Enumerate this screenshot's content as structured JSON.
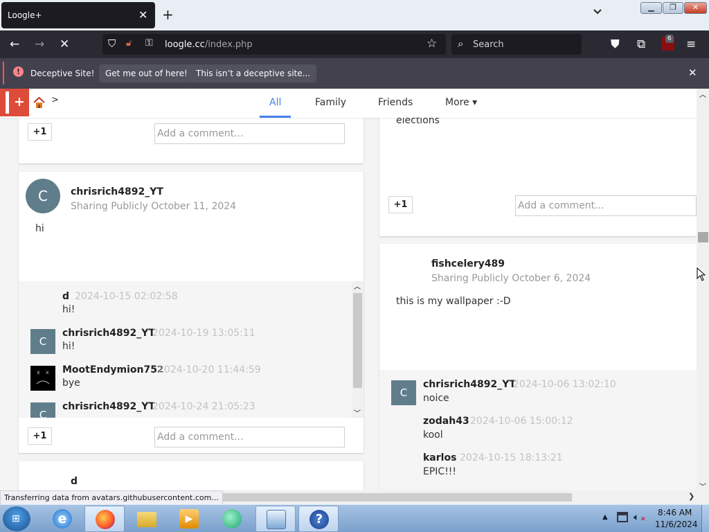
{
  "browser": {
    "tab_title": "Loogle+",
    "tab_close": "✕",
    "new_tab": "+",
    "tab_list": "⌄",
    "url_host": "loogle.cc",
    "url_path": "/index.php",
    "search_placeholder": "Search",
    "ublock_count": "6",
    "status_text": "Transferring data from avatars.githubusercontent.com..."
  },
  "warning": {
    "message": "Deceptive Site!",
    "get_out_button": "Get me out of here!",
    "not_deceptive_button": "This isn’t a deceptive site...",
    "close": "✕"
  },
  "site": {
    "crumb_separator": ">",
    "tabs": [
      {
        "label": "All",
        "active": true
      },
      {
        "label": "Family"
      },
      {
        "label": "Friends"
      },
      {
        "label": "More ▾"
      }
    ],
    "accent_color": "#427fed",
    "logo_color": "#dd4b39"
  },
  "common": {
    "plus_one": "+1",
    "comment_placeholder": "Add a comment..."
  },
  "left_column": {
    "post": {
      "avatar_letter": "C",
      "author": "chrisrich4892_YT",
      "meta": "Sharing Publicly October 11, 2024",
      "body": "hi",
      "comments": [
        {
          "user": "d",
          "time": "2024-10-15 02:02:58",
          "text": "hi!",
          "avatar": ""
        },
        {
          "user": "chrisrich4892_YT",
          "time": "2024-10-19 13:05:11",
          "text": "hi!",
          "avatar": "C"
        },
        {
          "user": "MootEndymion752",
          "time": "2024-10-20 11:44:59",
          "text": "bye",
          "avatar": "dark-face"
        },
        {
          "user": "chrisrich4892_YT",
          "time": "2024-10-24 21:05:23",
          "text": "",
          "avatar": "C"
        }
      ]
    },
    "next_post_author": "d"
  },
  "right_column": {
    "top_post_text": "elections",
    "post": {
      "author": "fishcelery489",
      "meta": "Sharing Publicly October 6, 2024",
      "body": "this is my wallpaper :-D",
      "comments": [
        {
          "user": "chrisrich4892_YT",
          "time": "2024-10-06 13:02:10",
          "text": "noice",
          "avatar": "C"
        },
        {
          "user": "zodah43",
          "time": "2024-10-06 15:00:12",
          "text": "kool",
          "avatar": ""
        },
        {
          "user": "karlos",
          "time": "2024-10-15 18:13:21",
          "text": "EPIC!!!",
          "avatar": ""
        }
      ]
    }
  },
  "taskbar": {
    "clock_time": "8:46 AM",
    "clock_date": "11/6/2024"
  }
}
